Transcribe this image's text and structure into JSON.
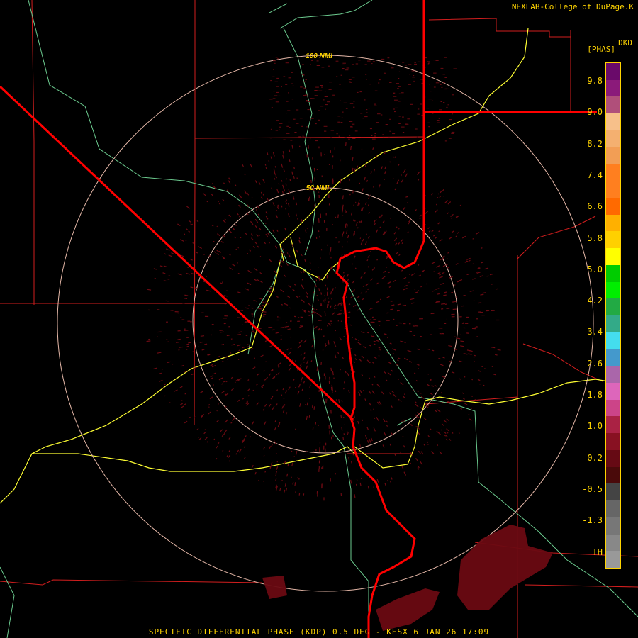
{
  "header": {
    "credit": "NEXLAB-College of DuPage.K"
  },
  "footer": {
    "caption": "SPECIFIC DIFFERENTIAL PHASE (KDP) 0.5 DEG - KESX 6 JAN 26 17:09"
  },
  "rings": [
    {
      "label": "100 NMI"
    },
    {
      "label": "50 NMI"
    }
  ],
  "legend": {
    "title": "DKD",
    "units": "[PHAS]",
    "ticks": [
      "9.8",
      "9.0",
      "8.2",
      "7.4",
      "6.6",
      "5.8",
      "5.0",
      "4.2",
      "3.4",
      "2.6",
      "1.8",
      "1.0",
      "0.2",
      "-0.5",
      "-1.3",
      "TH"
    ],
    "colors": [
      "#6a0a6a",
      "#8b1a7a",
      "#b04f7a",
      "#f7c08a",
      "#f4b070",
      "#f29e55",
      "#ff7f1f",
      "#ff7f1f",
      "#ff6a00",
      "#ffb000",
      "#ffd000",
      "#ffff00",
      "#00cc00",
      "#00ee00",
      "#22aa44",
      "#33aa88",
      "#44ddee",
      "#4499cc",
      "#aa66aa",
      "#dd66bb",
      "#cc4488",
      "#aa2244",
      "#881122",
      "#660a14",
      "#4a0a0a",
      "#444444",
      "#666666",
      "#777777",
      "#888888",
      "#999999"
    ]
  },
  "colors": {
    "text": "#ffd400",
    "rings": "#e6b8a8",
    "borders": "#d21e1e",
    "state_line": "#ff0000",
    "rivers": "#6ccb8f",
    "highways": "#ffff33",
    "echo": "#6a0a12"
  }
}
